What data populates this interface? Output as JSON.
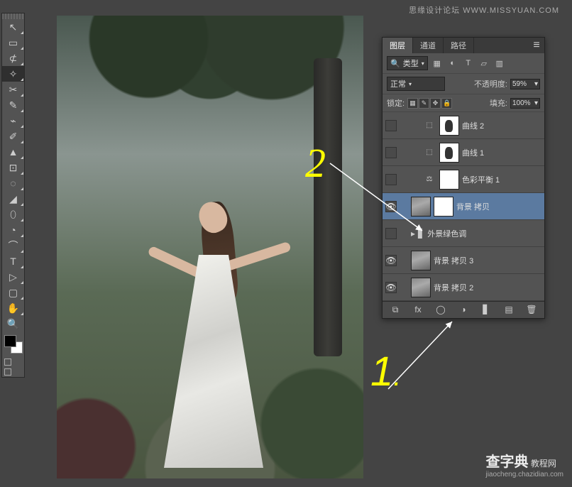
{
  "watermark": {
    "top": "思缘设计论坛 WWW.MISSYUAN.COM",
    "bottom_big": "查字典",
    "bottom_small": "教程网",
    "bottom_url": "jiaocheng.chazidian.com"
  },
  "annotations": {
    "one": "1",
    "two": "2",
    "dot": "."
  },
  "panel": {
    "tabs": {
      "layers": "图层",
      "channels": "通道",
      "paths": "路径"
    },
    "filter_kind": "类型",
    "blend_mode": "正常",
    "opacity_label": "不透明度:",
    "opacity_value": "59%",
    "lock_label": "锁定:",
    "fill_label": "填充:",
    "fill_value": "100%",
    "layers": [
      {
        "name": "曲线 2",
        "type": "curves",
        "visible": false,
        "indent": 2
      },
      {
        "name": "曲线 1",
        "type": "curves",
        "visible": false,
        "indent": 2
      },
      {
        "name": "色彩平衡 1",
        "type": "color-balance",
        "visible": false,
        "indent": 2
      },
      {
        "name": "背景 拷贝",
        "type": "image-mask",
        "visible": true,
        "indent": 1,
        "selected": true
      },
      {
        "name": "外景绿色调",
        "type": "folder",
        "visible": false,
        "indent": 1
      },
      {
        "name": "背景 拷贝 3",
        "type": "image",
        "visible": true,
        "indent": 1
      },
      {
        "name": "背景 拷贝 2",
        "type": "image",
        "visible": true,
        "indent": 1
      }
    ]
  },
  "icons": {
    "search": "🔍",
    "eye": "👁",
    "menu": "≡",
    "img": "▦",
    "adj": "◐",
    "text": "T",
    "shape": "▱",
    "fx": "▥",
    "link": "⧉",
    "fxlabel": "fx",
    "mask": "◯",
    "fill": "◑",
    "folder": "▋",
    "new": "▤",
    "trash": "🗑",
    "lock_img": "▦",
    "lock_brush": "✎",
    "lock_move": "✥",
    "lock_all": "🔒",
    "tools": [
      "↕",
      "▭",
      "⬚",
      "✧",
      "⊹",
      "✂",
      "✎",
      "↗",
      "⌁",
      "✐",
      "▲",
      "⊡",
      "◌",
      "◢",
      "⬯",
      "✋",
      "◔",
      "⌒",
      "↘",
      "T",
      "▷",
      "▢",
      "✋",
      "🔍"
    ]
  }
}
